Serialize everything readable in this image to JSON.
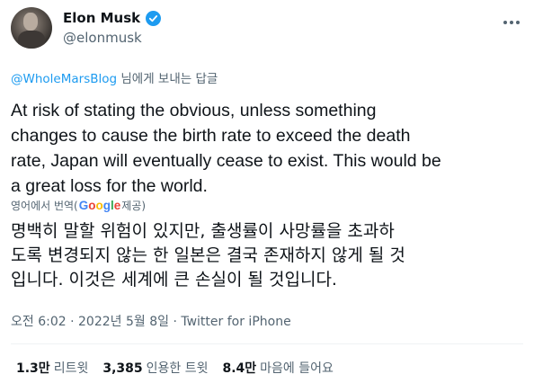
{
  "author": {
    "name": "Elon Musk",
    "handle": "@elonmusk"
  },
  "reply_to": {
    "handle": "@WholeMarsBlog",
    "suffix": " 님에게 보내는 답글"
  },
  "tweet": {
    "text_lines": [
      "At risk of stating the obvious, unless something",
      "changes to cause the birth rate to exceed the death",
      "rate, Japan will eventually cease to exist. This would be",
      "a great loss for the world."
    ]
  },
  "translation": {
    "attribution_prefix": "영어에서 번역(",
    "provider": "Google",
    "attribution_suffix": " 제공)",
    "lines": [
      "명백히 말할 위험이 있지만, 출생률이 사망률을 초과하",
      "도록 변경되지 않는 한 일본은 결국 존재하지 않게 될 것",
      "입니다. 이것은 세계에 큰 손실이 될 것입니다."
    ]
  },
  "meta": {
    "time": "오전 6:02",
    "sep1": " · ",
    "date": "2022년 5월 8일",
    "sep2": " · ",
    "source": "Twitter for iPhone"
  },
  "stats": {
    "retweets_num": "1.3만",
    "retweets_label": "리트윗",
    "quotes_num": "3,385",
    "quotes_label": "인용한 트윗",
    "likes_num": "8.4만",
    "likes_label": "마음에 들어요"
  },
  "colors": {
    "accent": "#1d9bf0",
    "text": "#0f1419",
    "secondary": "#536471",
    "divider": "#eff3f4"
  },
  "icons": {
    "verified": "verified-badge-icon",
    "more": "more-options-icon"
  }
}
